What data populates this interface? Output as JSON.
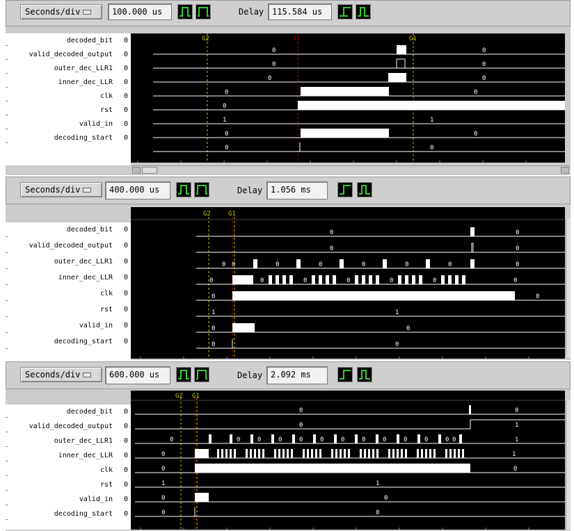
{
  "signals": [
    "decoded_bit",
    "valid_decoded_output",
    "outer_dec_LLR1",
    "inner_dec_LLR",
    "clk",
    "rst",
    "valid_in",
    "decoding_start"
  ],
  "signal_values": [
    "0",
    "0",
    "0",
    "0",
    "0",
    "0",
    "0",
    "0"
  ],
  "controls": {
    "seconds_div_label": "Seconds/div",
    "delay_label": "Delay"
  },
  "panels": [
    {
      "seconds_div": "100.000 us",
      "delay": "115.584 us",
      "markers": [
        "G2",
        "tr",
        "G1"
      ],
      "wave_values": [
        [
          "0",
          "0"
        ],
        [
          "0",
          "0"
        ],
        [
          "0",
          "0"
        ],
        [
          "0",
          "0"
        ],
        [
          "0"
        ],
        [
          "1",
          "1"
        ],
        [
          "0",
          "0"
        ],
        [
          "0",
          "0"
        ]
      ]
    },
    {
      "seconds_div": "400.000 us",
      "delay": "1.056 ms",
      "markers": [
        "G2",
        "G1"
      ],
      "wave_values": [
        [
          "0",
          "0"
        ],
        [
          "0",
          "0"
        ],
        [
          "0",
          "0",
          "0",
          "0",
          "0",
          "0",
          "0",
          "0"
        ],
        [
          "0",
          "0",
          "0",
          "0",
          "0",
          "0",
          "0"
        ],
        [
          "0",
          "0"
        ],
        [
          "1",
          "1"
        ],
        [
          "0",
          "0"
        ],
        [
          "0",
          "0"
        ]
      ]
    },
    {
      "seconds_div": "600.000 us",
      "delay": "2.092 ms",
      "markers": [
        "G2",
        "G1"
      ],
      "wave_values": [
        [
          "0",
          "0"
        ],
        [
          "0",
          "1"
        ],
        [
          "0",
          "0",
          "0",
          "0",
          "0",
          "0",
          "0",
          "0",
          "0",
          "0",
          "0",
          "0",
          "0",
          "1"
        ],
        [
          "0",
          "1"
        ],
        [
          "0",
          "0"
        ],
        [
          "1",
          "1"
        ],
        [
          "0",
          "0"
        ],
        [
          "0",
          "0"
        ]
      ]
    }
  ],
  "colors": {
    "wave_bg": "#000000",
    "trace": "#ffffff",
    "cursor_g": "#c8c800",
    "cursor_tr": "#b00000",
    "pulse_icon": "#3c3"
  }
}
